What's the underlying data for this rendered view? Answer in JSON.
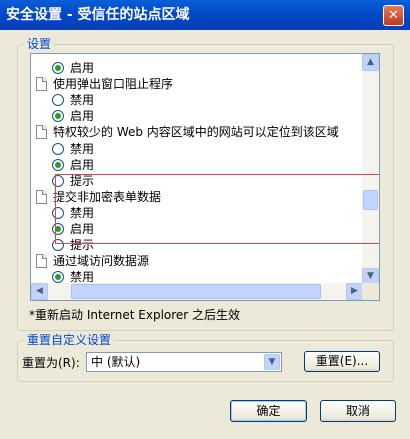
{
  "window": {
    "title": "安全设置 - 受信任的站点区域"
  },
  "settings_group": {
    "caption": "设置"
  },
  "settings_list": {
    "rows": [
      {
        "kind": "option",
        "label": "启用",
        "checked": true
      },
      {
        "kind": "setting",
        "label": "使用弹出窗口阻止程序"
      },
      {
        "kind": "option",
        "label": "禁用",
        "checked": false
      },
      {
        "kind": "option",
        "label": "启用",
        "checked": true
      },
      {
        "kind": "setting",
        "label": "特权较少的 Web 内容区域中的网站可以定位到该区域"
      },
      {
        "kind": "option",
        "label": "禁用",
        "checked": false
      },
      {
        "kind": "option",
        "label": "启用",
        "checked": true
      },
      {
        "kind": "option",
        "label": "提示",
        "checked": false
      },
      {
        "kind": "setting",
        "label": "提交非加密表单数据"
      },
      {
        "kind": "option",
        "label": "禁用",
        "checked": false
      },
      {
        "kind": "option",
        "label": "启用",
        "checked": true
      },
      {
        "kind": "option",
        "label": "提示",
        "checked": false
      },
      {
        "kind": "setting",
        "label": "通过域访问数据源"
      },
      {
        "kind": "option",
        "label": "禁用",
        "checked": true
      }
    ]
  },
  "restart_note": "*重新启动 Internet Explorer 之后生效",
  "reset_group": {
    "caption": "重置自定义设置",
    "reset_to_label": "重置为(R):",
    "reset_level_value": "中 (默认)",
    "reset_button": "重置(E)..."
  },
  "dialog_buttons": {
    "ok": "确定",
    "cancel": "取消"
  }
}
